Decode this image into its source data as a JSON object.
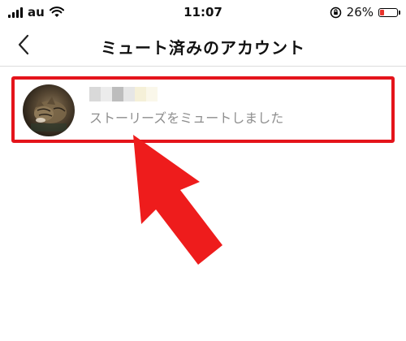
{
  "status_bar": {
    "carrier": "au",
    "time": "11:07",
    "battery_percent": "26%",
    "battery_level": 0.26
  },
  "header": {
    "title": "ミュート済みのアカウント"
  },
  "muted_accounts": [
    {
      "username": "",
      "status": "ストーリーズをミュートしました"
    }
  ],
  "colors": {
    "highlight": "#e4141b",
    "arrow": "#ee1c1c",
    "subtitle_text": "#8e8e8e"
  }
}
